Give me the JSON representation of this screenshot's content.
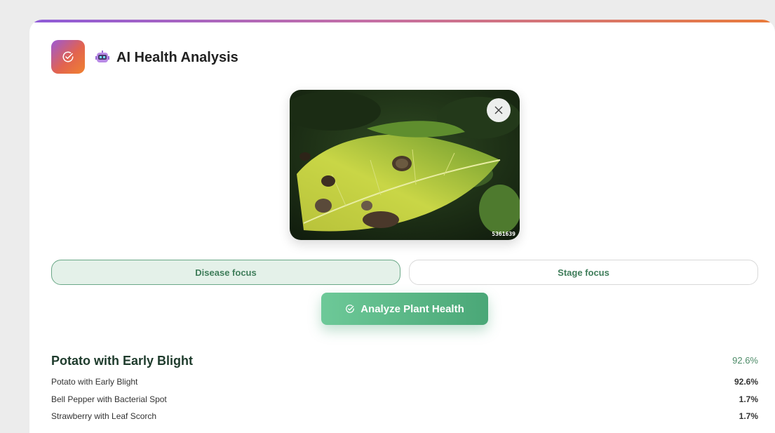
{
  "header": {
    "title": "AI Health Analysis"
  },
  "image": {
    "watermark": "5361639"
  },
  "focus": {
    "disease_label": "Disease focus",
    "stage_label": "Stage focus",
    "selected": "Disease focus"
  },
  "actions": {
    "analyze_label": "Analyze Plant Health"
  },
  "result": {
    "top_label": "Potato with Early Blight",
    "top_confidence": "92.6%",
    "predictions": [
      {
        "label": "Potato with Early Blight",
        "value": "92.6%"
      },
      {
        "label": "Bell Pepper with Bacterial Spot",
        "value": "1.7%"
      },
      {
        "label": "Strawberry with Leaf Scorch",
        "value": "1.7%"
      }
    ]
  },
  "colors": {
    "accent_green": "#4aa777",
    "gradient_start": "#8e5bd8",
    "gradient_end": "#e97b3a"
  },
  "icons": {
    "header_badge": "check-circle-icon",
    "title_emoji": "robot-icon",
    "remove": "close-icon",
    "analyze": "check-circle-icon"
  }
}
